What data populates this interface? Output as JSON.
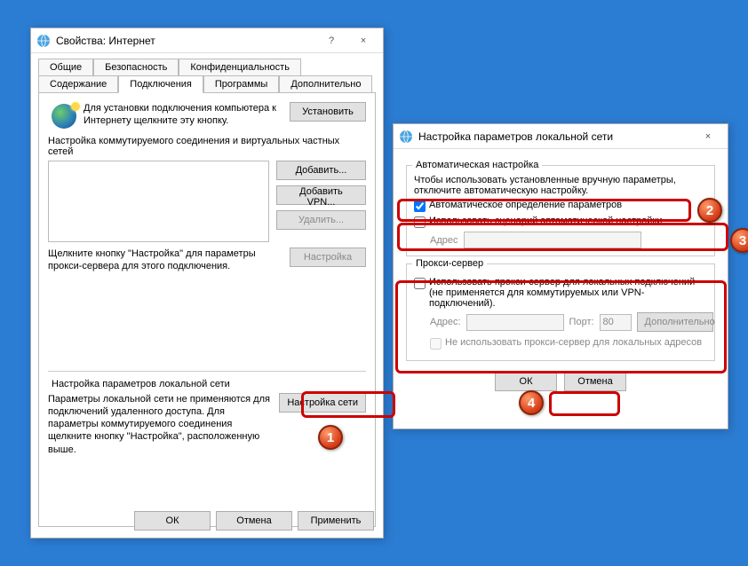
{
  "mainDialog": {
    "title": "Свойства: Интернет",
    "help": "?",
    "close": "×",
    "tabsRow1": [
      "Общие",
      "Безопасность",
      "Конфиденциальность"
    ],
    "tabsRow2": [
      "Содержание",
      "Подключения",
      "Программы",
      "Дополнительно"
    ],
    "activeTab": "Подключения",
    "setup": {
      "desc": "Для установки подключения компьютера к Интернету щелкните эту кнопку.",
      "button": "Установить"
    },
    "dial": {
      "legend": "Настройка коммутируемого соединения и виртуальных частных сетей",
      "add": "Добавить...",
      "addVpn": "Добавить VPN...",
      "remove": "Удалить...",
      "proxyNote": "Щелкните кнопку \"Настройка\" для параметры прокси-сервера для этого подключения.",
      "settings": "Настройка"
    },
    "lanSection": {
      "legend": "Настройка параметров локальной сети",
      "note": "Параметры локальной сети не применяются для подключений удаленного доступа. Для параметры коммутируемого соединения щелкните кнопку \"Настройка\", расположенную выше.",
      "button": "Настройка сети"
    },
    "footer": {
      "ok": "ОК",
      "cancel": "Отмена",
      "apply": "Применить"
    }
  },
  "lanDialog": {
    "title": "Настройка параметров локальной сети",
    "close": "×",
    "auto": {
      "legend": "Автоматическая настройка",
      "note": "Чтобы использовать установленные вручную параметры, отключите автоматическую настройку.",
      "detect": "Автоматическое определение параметров",
      "script": "Использовать сценарий автоматической настройки",
      "addressLabel": "Адрес"
    },
    "proxy": {
      "legend": "Прокси-сервер",
      "use": "Использовать прокси-сервер для локальных подключений (не применяется для коммутируемых или VPN-подключений).",
      "addressLabel": "Адрес:",
      "portLabel": "Порт:",
      "portValue": "80",
      "advanced": "Дополнительно",
      "bypass": "Не использовать прокси-сервер для локальных адресов"
    },
    "footer": {
      "ok": "ОК",
      "cancel": "Отмена"
    }
  },
  "badges": {
    "b1": "1",
    "b2": "2",
    "b3": "3",
    "b4": "4"
  }
}
